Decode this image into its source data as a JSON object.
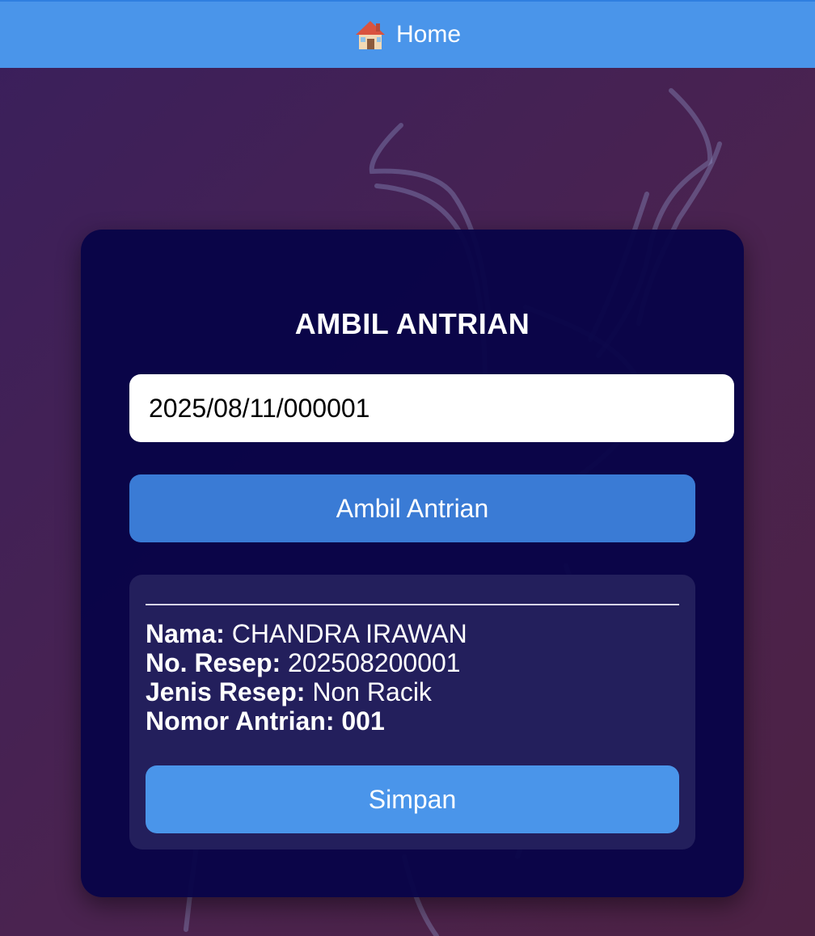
{
  "nav": {
    "home_label": "Home",
    "home_icon": "house-icon"
  },
  "queue": {
    "title": "AMBIL ANTRIAN",
    "ticket_input_value": "2025/08/11/000001",
    "ambil_button_label": "Ambil Antrian"
  },
  "result": {
    "name_label": "Nama:",
    "name_value": "CHANDRA IRAWAN",
    "recipe_no_label": "No. Resep:",
    "recipe_no_value": "202508200001",
    "recipe_type_label": "Jenis Resep:",
    "recipe_type_value": "Non Racik",
    "queue_no_label": "Nomor Antrian:",
    "queue_no_value": "001",
    "save_button_label": "Simpan"
  },
  "colors": {
    "topbar": "#4a95ea",
    "card": "#080448",
    "primary_button": "#3a7bd5",
    "save_button": "#4a95ea"
  }
}
